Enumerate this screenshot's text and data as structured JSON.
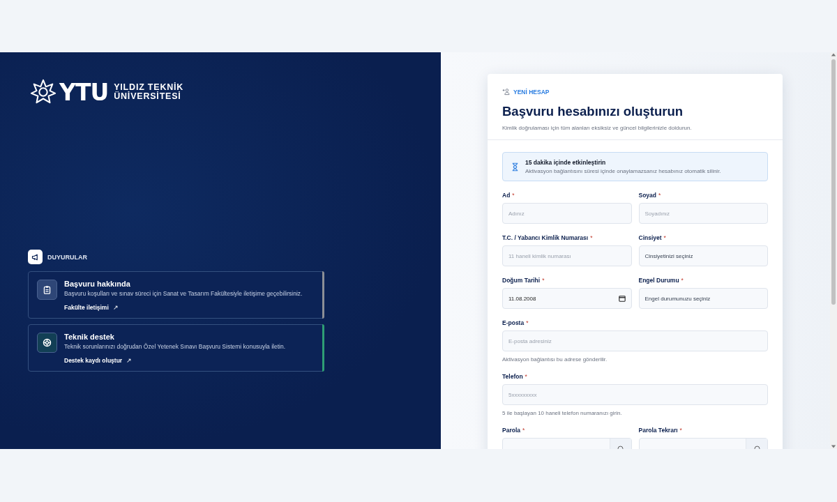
{
  "brand": {
    "mark": "YTU",
    "name_lines": [
      "YILDIZ TEKNİK",
      "ÜNİVERSİTESİ"
    ]
  },
  "announcements": {
    "title": "DUYURULAR",
    "items": [
      {
        "kind": "clipboard",
        "title": "Başvuru hakkında",
        "text": "Başvuru koşulları ve sınav süreci için Sanat ve Tasarım Fakültesiyle iletişime geçebilirsiniz.",
        "link": "Fakülte iletişimi",
        "link_icon": "↗",
        "color": "#8c8f96"
      },
      {
        "kind": "lifebuoy",
        "title": "Teknik destek",
        "text": "Teknik sorunlarınızı doğrudan Özel Yetenek Sınavı Başvuru Sistemi konusuyla iletin.",
        "link": "Destek kaydı oluştur",
        "link_icon": "↗",
        "color": "#2e9e74"
      }
    ]
  },
  "form": {
    "eyebrow": "YENİ HESAP",
    "title": "Başvuru hesabınızı oluşturun",
    "subtitle": "Kimlik doğrulaması için tüm alanları eksiksiz ve güncel bilgilerinizle doldurun.",
    "notice": {
      "title": "15 dakika içinde etkinleştirin",
      "text": "Aktivasyon bağlantısını süresi içinde onaylamazsanız hesabınız otomatik silinir."
    },
    "rows": [
      {
        "fields": [
          {
            "kind": "text",
            "label": "Ad",
            "required_mark": "*",
            "placeholder": "Adınız"
          },
          {
            "kind": "text",
            "label": "Soyad",
            "required_mark": "*",
            "placeholder": "Soyadınız"
          }
        ]
      },
      {
        "fields": [
          {
            "kind": "text",
            "label": "T.C. / Yabancı Kimlik Numarası",
            "required_mark": "*",
            "placeholder": "11 haneli kimlik numarası"
          },
          {
            "kind": "select",
            "label": "Cinsiyet",
            "required_mark": "*",
            "value": "Cinsiyetinizi seçiniz"
          }
        ]
      },
      {
        "fields": [
          {
            "kind": "date",
            "label": "Doğum Tarihi",
            "required_mark": "*",
            "value": "11.08.2008"
          },
          {
            "kind": "select",
            "label": "Engel Durumu",
            "required_mark": "*",
            "value": "Engel durumunuzu seçiniz"
          }
        ]
      },
      {
        "fields": [
          {
            "kind": "text",
            "label": "E-posta",
            "required_mark": "*",
            "placeholder": "E-posta adresiniz",
            "hint": "Aktivasyon bağlantısı bu adrese gönderilir."
          }
        ]
      },
      {
        "fields": [
          {
            "kind": "text",
            "label": "Telefon",
            "required_mark": "*",
            "placeholder": "5xxxxxxxxx",
            "hint": "5 ile başlayan 10 haneli telefon numaranızı girin."
          }
        ]
      },
      {
        "fields": [
          {
            "kind": "password",
            "label": "Parola",
            "required_mark": "*"
          },
          {
            "kind": "password",
            "label": "Parola Tekrarı",
            "required_mark": "*"
          }
        ]
      }
    ]
  }
}
